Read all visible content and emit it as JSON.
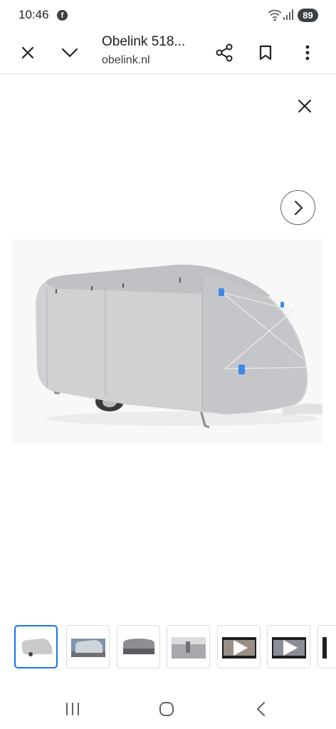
{
  "status_bar": {
    "time": "10:46",
    "app_icon": "facebook-icon",
    "battery": "89"
  },
  "toolbar": {
    "title": "Obelink 518...",
    "url": "obelink.nl",
    "icons": [
      "close-icon",
      "chevron-down-icon",
      "share-icon",
      "bookmark-icon",
      "more-vert-icon"
    ]
  },
  "viewer": {
    "close_icon": "close-icon",
    "next_icon": "chevron-right-icon",
    "image_subject": "covered-caravan"
  },
  "thumbnails": {
    "selected_index": 0,
    "items": [
      "caravan-cover",
      "caravan-outdoor",
      "caravan-rear",
      "cover-detail",
      "video",
      "video",
      "more"
    ]
  },
  "navbar": {
    "icons": [
      "recent-apps-icon",
      "home-icon",
      "back-icon"
    ]
  },
  "colors": {
    "accent": "#1a73e8",
    "cover_gray": "#cfd1d3",
    "strap_blue": "#3f88e8"
  }
}
